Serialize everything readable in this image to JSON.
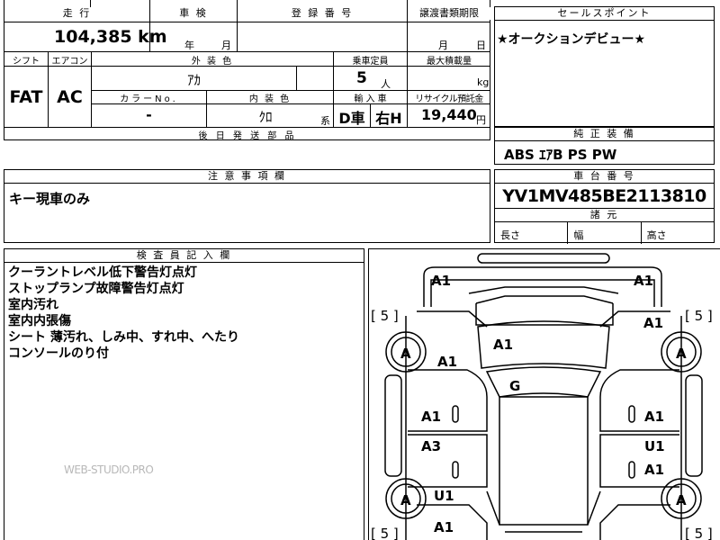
{
  "sheet": {
    "mileage": {
      "header": "走 行",
      "value": "104,385",
      "unit": "km"
    },
    "inspection": {
      "header": "車 検",
      "year_unit": "年",
      "month_unit": "月"
    },
    "registration": {
      "header": "登 録 番 号"
    },
    "transfer": {
      "header": "譲渡書類期限",
      "month_unit": "月",
      "day_unit": "日"
    },
    "sales_point": {
      "header": "セールスポイント",
      "text": "★オークションデビュー★"
    },
    "shift": {
      "header": "シフト",
      "value": "FAT"
    },
    "aircon": {
      "header": "エアコン",
      "value": "AC"
    },
    "exterior": {
      "header": "外 装 色",
      "value": "ｱｶ"
    },
    "capacity": {
      "header": "乗車定員",
      "value": "5",
      "unit": "人"
    },
    "max_load": {
      "header": "最大積載量",
      "unit": "kg"
    },
    "color_no": {
      "header": "カラーNo.",
      "value": "-"
    },
    "interior": {
      "header": "内 装 色",
      "value": "ｸﾛ",
      "suffix": "系"
    },
    "import": {
      "header": "輸 入 車",
      "value1": "D車",
      "value2": "右H"
    },
    "recycle": {
      "header": "リサイクル預託金",
      "value": "19,440",
      "unit": "円"
    },
    "rear_parts": {
      "header": "後 日 発 送 部 品"
    },
    "equipment": {
      "header": "純 正 装 備",
      "text": "ABS ｴｱB PS PW"
    },
    "notes": {
      "header": "注 意 事 項 欄",
      "text": "キー現車のみ"
    },
    "chassis": {
      "header": "車 台 番 号",
      "value": "YV1MV485BE2113810"
    },
    "dimensions": {
      "header": "諸 元",
      "length": "長さ",
      "width": "幅",
      "height": "高さ"
    },
    "inspector": {
      "header": "検 査 員 記 入 欄",
      "lines": [
        "クーラントレベル低下警告灯点灯",
        "ストップランプ故障警告灯点灯",
        "室内汚れ",
        "室内内張傷",
        "シート 薄汚れ、しみ中、すれ中、へたり",
        "コンソールのり付"
      ]
    },
    "watermark": "WEB-STUDIO.PRO"
  },
  "diagram": {
    "marks": {
      "front_left": "A1",
      "front_right": "A1",
      "bracket_top_left": "[ 5 ]",
      "bracket_top_right": "[ 5 ]",
      "bracket_bottom_left": "[ 5 ]",
      "bracket_bottom_right": "[ 5 ]",
      "wheel_fl": "A",
      "wheel_fr": "A",
      "wheel_rl": "A",
      "wheel_rr": "A",
      "hood": "A1",
      "left_fender": "A1",
      "right_fender": "A1",
      "glass": "G",
      "left_front_door": "A1",
      "right_front_door": "A1",
      "left_rear_door": "A3",
      "right_rear_door_upper": "U1",
      "right_rear_door_lower": "A1",
      "left_quarter": "U1",
      "rear_left": "A1"
    }
  }
}
